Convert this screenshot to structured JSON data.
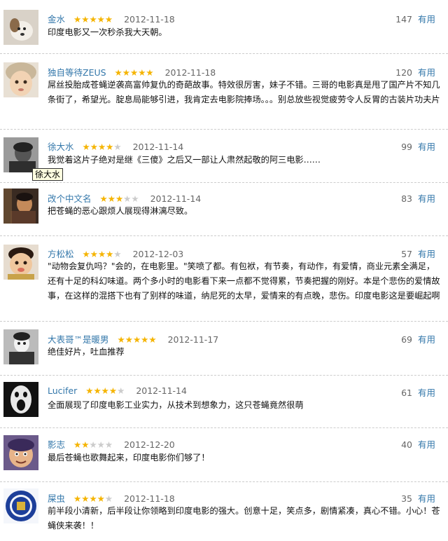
{
  "tooltip": "徐大水",
  "useful_label": "有用",
  "reviews": [
    {
      "user": "金水",
      "rating": 5,
      "date": "2012-11-18",
      "votes": "147",
      "text": "印度电影又一次秒杀我大天朝。"
    },
    {
      "user": "独自等待ZEUS",
      "rating": 5,
      "date": "2012-11-18",
      "votes": "120",
      "text": "屌丝投胎成苍蝇逆袭高富帅复仇的奇葩故事。特效很厉害，妹子不错。三哥的电影真是甩了国产片不知几条街了，希望光。腚息局能够引进，我肯定去电影院捧场。。。别总放些视觉疲劳令人反胃的古装片功夫片"
    },
    {
      "user": "徐大水",
      "rating": 4,
      "date": "2012-11-14",
      "votes": "99",
      "text": "我觉着这片子绝对是继《三傻》之后又一部让人肃然起敬的阿三电影……"
    },
    {
      "user": "改个中文名",
      "rating": 3,
      "date": "2012-11-14",
      "votes": "83",
      "text": "把苍蝇的恶心跟烦人展现得淋漓尽致。"
    },
    {
      "user": "方松松",
      "rating": 4,
      "date": "2012-12-03",
      "votes": "57",
      "text": "\"动物会复仇吗？\"会的，在电影里。\"笑喷了都。有包袱，有节奏，有动作，有爱情，商业元素全满足，还有十足的科幻味道。两个多小时的电影看下来一点都不觉得累，节奏把握的刚好。本是个悲伤的爱情故事，在这样的混搭下也有了别样的味道，纳尼死的太早，爱情来的有点晚，悲伤。印度电影这是要崛起啊"
    },
    {
      "user": "大表哥™是暖男",
      "rating": 5,
      "date": "2012-11-17",
      "votes": "69",
      "text": "绝佳好片，吐血推荐"
    },
    {
      "user": "Lucifer",
      "rating": 4,
      "date": "2012-11-14",
      "votes": "61",
      "text": "全面展现了印度电影工业实力，从技术到想象力，这只苍蝇竟然很萌"
    },
    {
      "user": "影志",
      "rating": 2,
      "date": "2012-12-20",
      "votes": "40",
      "text": "最后苍蝇也歌舞起来，印度电影你们够了！"
    },
    {
      "user": "屎虫",
      "rating": 4,
      "date": "2012-11-18",
      "votes": "35",
      "text": "前半段小清新，后半段让你领略到印度电影的强大。创意十足，笑点多，剧情紧凑，真心不错。小心！苍蝇侠来袭！！"
    }
  ]
}
